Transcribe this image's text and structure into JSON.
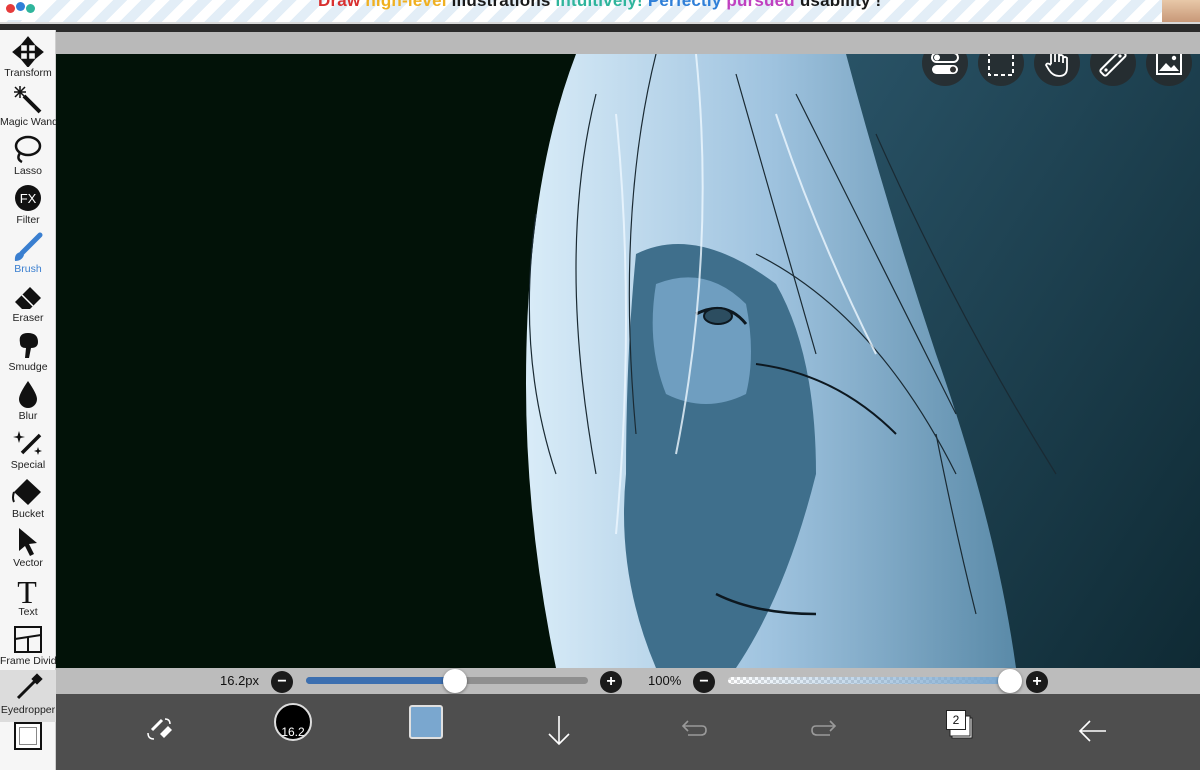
{
  "banner": {
    "words": [
      "Draw",
      "high-level",
      "illustrations",
      "intuitively!",
      "Perfectly",
      "pursued",
      "usability !"
    ]
  },
  "toolbar": {
    "items": [
      {
        "label": "Transform",
        "icon": "transform-icon"
      },
      {
        "label": "Magic Wand",
        "icon": "magic-wand-icon"
      },
      {
        "label": "Lasso",
        "icon": "lasso-icon"
      },
      {
        "label": "Filter",
        "icon": "filter-icon"
      },
      {
        "label": "Brush",
        "icon": "brush-icon",
        "active": true
      },
      {
        "label": "Eraser",
        "icon": "eraser-icon"
      },
      {
        "label": "Smudge",
        "icon": "smudge-icon"
      },
      {
        "label": "Blur",
        "icon": "blur-icon"
      },
      {
        "label": "Special",
        "icon": "special-icon"
      },
      {
        "label": "Bucket",
        "icon": "bucket-icon"
      },
      {
        "label": "Vector",
        "icon": "vector-icon"
      },
      {
        "label": "Text",
        "icon": "text-icon"
      },
      {
        "label": "Frame Divider",
        "icon": "frame-divider-icon"
      },
      {
        "label": "Eyedropper",
        "icon": "eyedropper-icon"
      }
    ],
    "filter_glyph": "FX",
    "text_glyph": "T"
  },
  "quick_actions": [
    "toggle-icon",
    "selection-icon",
    "hand-icon",
    "ruler-icon",
    "image-icon"
  ],
  "sliders": {
    "brush_size": {
      "readout": "16.2px",
      "minus": "−",
      "plus": "+",
      "level": 0.53,
      "color": "#3c6fb0"
    },
    "opacity": {
      "readout": "100%",
      "minus": "−",
      "plus": "+",
      "level": 1.0
    }
  },
  "bottom_bar": {
    "brush_size_value": "16.2",
    "current_color": "#7aa7cf",
    "layer_count": "2",
    "icons": [
      "swap-tools-icon",
      "brush-size-icon",
      "color-swatch",
      "download-icon",
      "undo-icon",
      "redo-icon",
      "layers-icon",
      "back-arrow-icon"
    ]
  },
  "colors": {
    "canvas_bg": "#021208",
    "accent": "#3a7fd0",
    "bottom_bar": "#4e4e4e"
  }
}
